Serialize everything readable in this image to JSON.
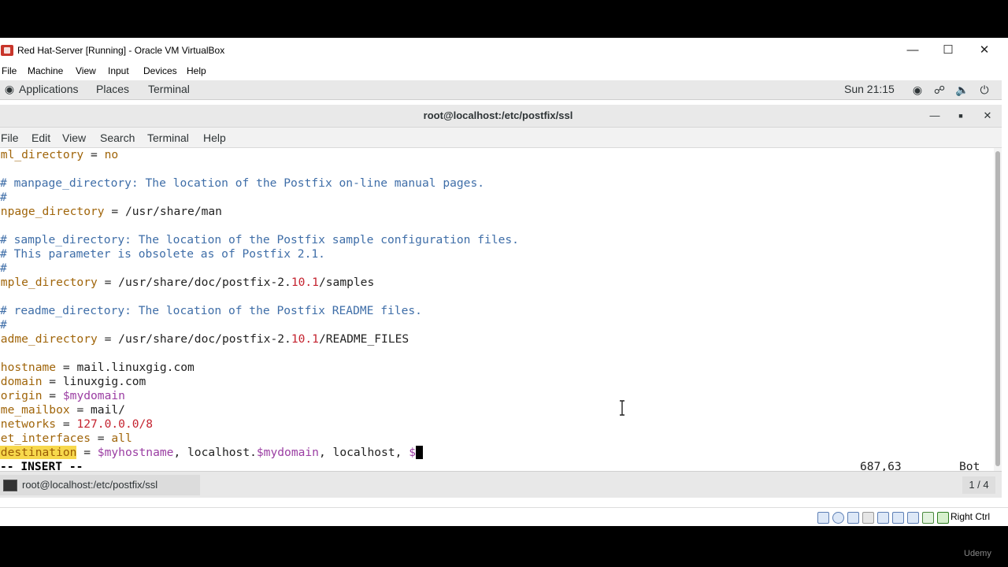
{
  "vbox": {
    "title": "Red Hat-Server [Running] - Oracle VM VirtualBox",
    "menu": [
      "File",
      "Machine",
      "View",
      "Input",
      "Devices",
      "Help"
    ],
    "host_key": "Right Ctrl"
  },
  "gnome": {
    "applications": "Applications",
    "places": "Places",
    "terminal": "Terminal",
    "clock": "Sun 21:15"
  },
  "terminal": {
    "title": "root@localhost:/etc/postfix/ssl",
    "menu": [
      "File",
      "Edit",
      "View",
      "Search",
      "Terminal",
      "Help"
    ],
    "lines": {
      "html_dir_key": "tml_directory",
      "html_dir_val": "no",
      "manpage_comment": "# manpage_directory: The location of the Postfix on-line manual pages.",
      "hash": "#",
      "manpage_key": "anpage_directory",
      "manpage_val": "/usr/share/man",
      "sample_comment1": "# sample_directory: The location of the Postfix sample configuration files.",
      "sample_comment2": "# This parameter is obsolete as of Postfix 2.1.",
      "sample_key": "ample_directory",
      "sample_val_a": "/usr/share/doc/postfix-2.",
      "sample_val_num": "10.1",
      "sample_val_b": "/samples",
      "readme_comment": "# readme_directory: The location of the Postfix README files.",
      "readme_key": "eadme_directory",
      "readme_val_a": "/usr/share/doc/postfix-2.",
      "readme_val_num": "10.1",
      "readme_val_b": "/README_FILES",
      "myhostname_key": "yhostname",
      "myhostname_val": "mail.linuxgig.com",
      "mydomain_key": "ydomain",
      "mydomain_val": "linuxgig.com",
      "myorigin_key": "yorigin",
      "myorigin_val": "$mydomain",
      "home_key": "ome_mailbox",
      "home_val": "mail/",
      "mynetworks_key": "ynetworks",
      "mynetworks_val": "127.0.0.0/8",
      "inet_key": "net_interfaces",
      "inet_val": "all",
      "mydest_key": "ydestination",
      "mydest_v1": "$myhostname",
      "mydest_t1": ", localhost.",
      "mydest_v2": "$mydomain",
      "mydest_t2": ", localhost, ",
      "mydest_v3": "$",
      "insert_mode": "-- INSERT --",
      "position": "687,63",
      "scroll": "Bot"
    }
  },
  "taskbar": {
    "window_label": "root@localhost:/etc/postfix/ssl",
    "workspace": "1 / 4"
  },
  "watermark": "Udemy"
}
